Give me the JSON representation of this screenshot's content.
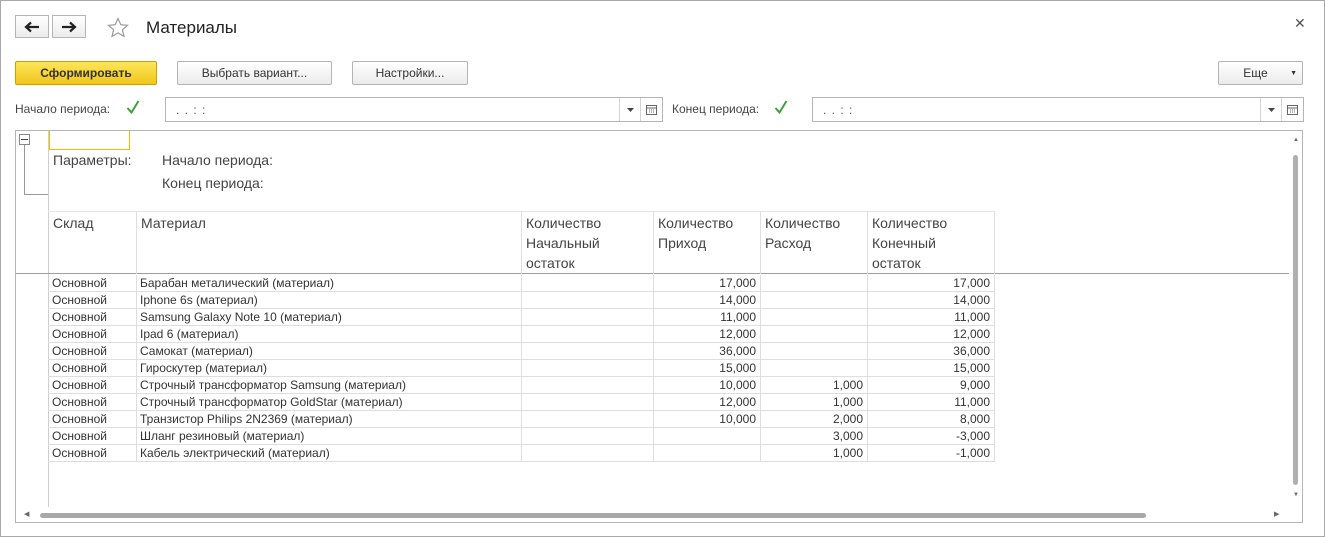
{
  "window": {
    "title": "Материалы"
  },
  "toolbar": {
    "generate_label": "Сформировать",
    "select_variant_label": "Выбрать вариант...",
    "settings_label": "Настройки...",
    "more_label": "Еще"
  },
  "period": {
    "start_label": "Начало периода:",
    "end_label": "Конец периода:",
    "start_value": ". .    : :",
    "end_value": ". .    : :"
  },
  "report": {
    "params_label": "Параметры:",
    "param_start": "Начало периода:",
    "param_end": "Конец периода:",
    "columns": [
      {
        "l1": "Склад",
        "l2": "",
        "l3": ""
      },
      {
        "l1": "Материал",
        "l2": "",
        "l3": ""
      },
      {
        "l1": "Количество",
        "l2": "Начальный",
        "l3": "остаток"
      },
      {
        "l1": "Количество",
        "l2": "Приход",
        "l3": ""
      },
      {
        "l1": "Количество",
        "l2": "Расход",
        "l3": ""
      },
      {
        "l1": "Количество",
        "l2": "Конечный",
        "l3": "остаток"
      }
    ],
    "rows": [
      {
        "warehouse": "Основной",
        "material": "Барабан металический (материал)",
        "start": "",
        "in": "17,000",
        "out": "",
        "end": "17,000"
      },
      {
        "warehouse": "Основной",
        "material": "Iphone 6s (материал)",
        "start": "",
        "in": "14,000",
        "out": "",
        "end": "14,000"
      },
      {
        "warehouse": "Основной",
        "material": "Samsung Galaxy Note 10 (материал)",
        "start": "",
        "in": "11,000",
        "out": "",
        "end": "11,000"
      },
      {
        "warehouse": "Основной",
        "material": "Ipad 6 (материал)",
        "start": "",
        "in": "12,000",
        "out": "",
        "end": "12,000"
      },
      {
        "warehouse": "Основной",
        "material": "Самокат (материал)",
        "start": "",
        "in": "36,000",
        "out": "",
        "end": "36,000"
      },
      {
        "warehouse": "Основной",
        "material": "Гироскутер (материал)",
        "start": "",
        "in": "15,000",
        "out": "",
        "end": "15,000"
      },
      {
        "warehouse": "Основной",
        "material": "Строчный трансформатор Samsung (материал)",
        "start": "",
        "in": "10,000",
        "out": "1,000",
        "end": "9,000"
      },
      {
        "warehouse": "Основной",
        "material": "Строчный трансформатор GoldStar (материал)",
        "start": "",
        "in": "12,000",
        "out": "1,000",
        "end": "11,000"
      },
      {
        "warehouse": "Основной",
        "material": "Транзистор Philips 2N2369 (материал)",
        "start": "",
        "in": "10,000",
        "out": "2,000",
        "end": "8,000"
      },
      {
        "warehouse": "Основной",
        "material": "Шланг резиновый (материал)",
        "start": "",
        "in": "",
        "out": "3,000",
        "end": "-3,000"
      },
      {
        "warehouse": "Основной",
        "material": "Кабель электрический (материал)",
        "start": "",
        "in": "",
        "out": "1,000",
        "end": "-1,000"
      }
    ]
  }
}
